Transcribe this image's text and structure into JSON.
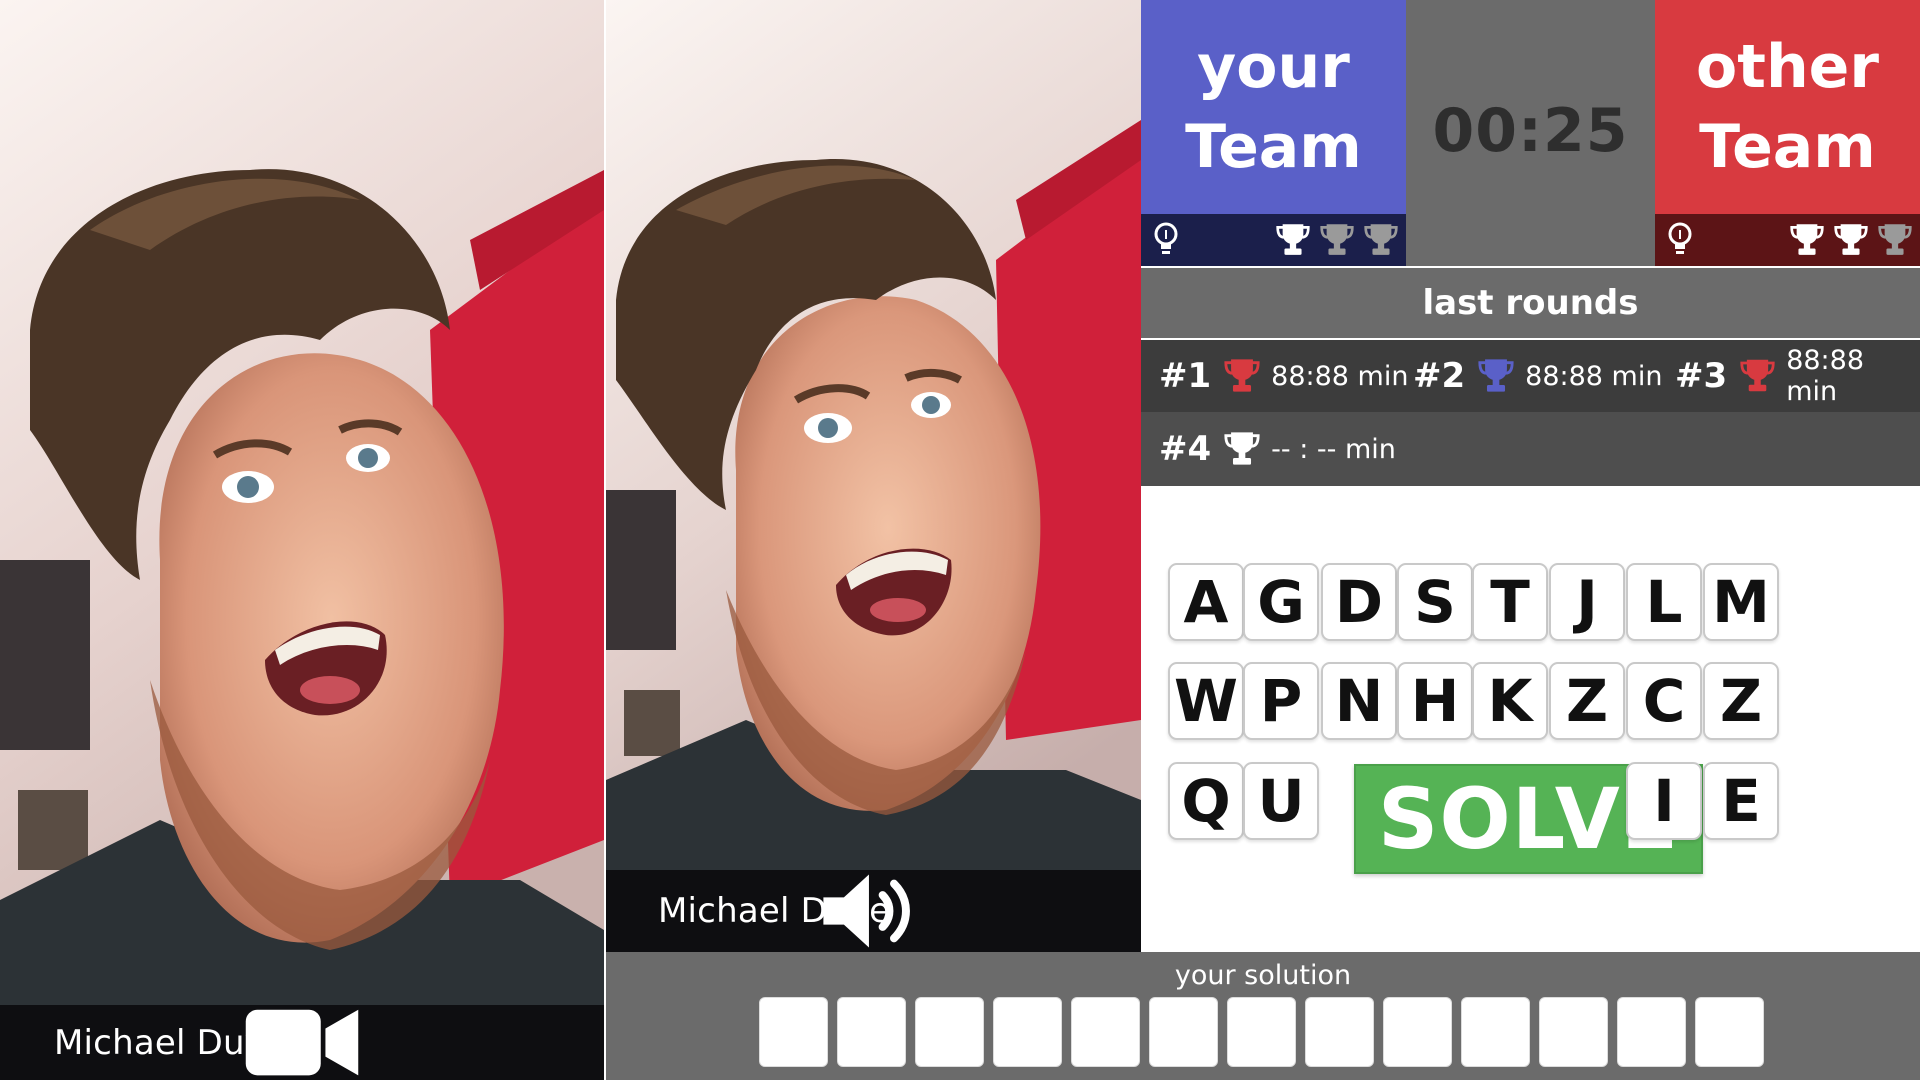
{
  "videos": [
    {
      "name": "Michael Duve",
      "status_icon": "video-camera-icon"
    },
    {
      "name": "Michael Duve",
      "status_icon": "speaker-icon"
    }
  ],
  "teams": {
    "yours": {
      "line1": "your",
      "line2": "Team",
      "color": "#5a60c8",
      "bar_color": "#1b1f4b",
      "trophies_won": 1,
      "trophies_total": 3
    },
    "other": {
      "line1": "other",
      "line2": "Team",
      "color": "#d83a40",
      "bar_color": "#5c1416",
      "trophies_won": 2,
      "trophies_total": 3
    }
  },
  "timer": "00:25",
  "last_rounds": {
    "title": "last rounds",
    "rounds": [
      {
        "num": "#1",
        "time": "88:88 min",
        "trophy_color": "#d83a40"
      },
      {
        "num": "#2",
        "time": "88:88 min",
        "trophy_color": "#5a60c8"
      },
      {
        "num": "#3",
        "time": "88:88 min",
        "trophy_color": "#d83a40"
      },
      {
        "num": "#4",
        "time": "-- : -- min",
        "trophy_color": "#ffffff"
      }
    ]
  },
  "letters": {
    "row1": [
      "A",
      "G",
      "D",
      "S",
      "T",
      "J",
      "L",
      "M"
    ],
    "row2": [
      "W",
      "P",
      "N",
      "H",
      "K",
      "Z",
      "C",
      "Z"
    ],
    "row3_left": [
      "Q",
      "U"
    ],
    "row3_right": [
      "I",
      "E"
    ]
  },
  "solve_label": "SOLVE",
  "solve_color": "#55b355",
  "solution": {
    "label": "your solution",
    "slot_count": 13
  }
}
